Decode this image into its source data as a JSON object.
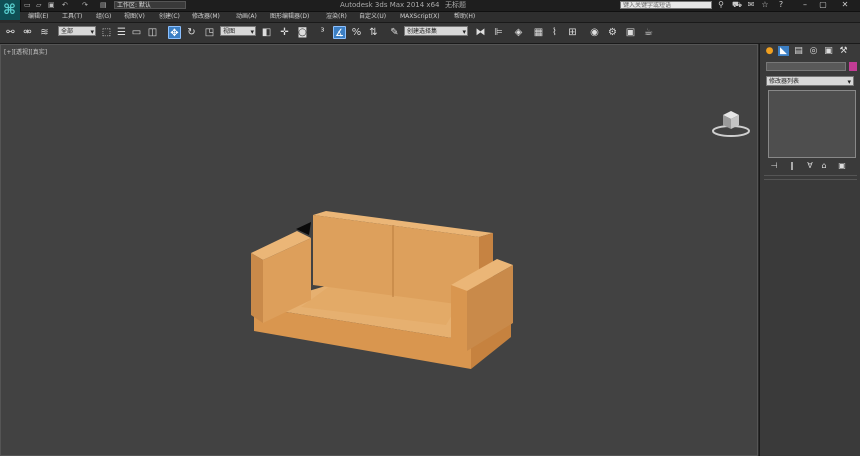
{
  "titlebar": {
    "workspace_label": "工作区: 默认",
    "app_title": "Autodesk 3ds Max  2014 x64",
    "document_title": "无标题",
    "search_placeholder": "键入关键字或短语"
  },
  "menu": [
    "编辑(E)",
    "工具(T)",
    "组(G)",
    "视图(V)",
    "创建(C)",
    "修改器(M)",
    "动画(A)",
    "图形编辑器(D)",
    "渲染(R)",
    "自定义(U)",
    "MAXScript(X)",
    "帮助(H)"
  ],
  "toolbar": {
    "selection_filter": "全部",
    "ref_coord": "视图",
    "named_selection": "创建选择集"
  },
  "viewport": {
    "label": "[+][透视][真实]"
  },
  "command_panel": {
    "modifier_list": "修改器列表"
  },
  "colors": {
    "accent_active": "#3c7fc4",
    "object_color": "#c23c95",
    "sofa": "#d99a52"
  }
}
